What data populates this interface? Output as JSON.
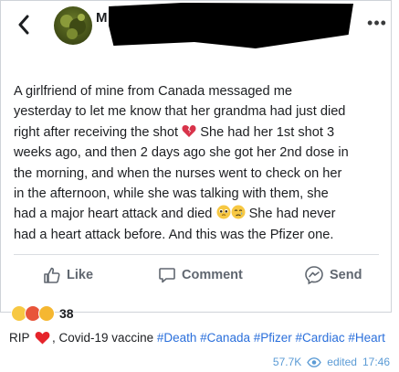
{
  "header": {
    "author_name": "M",
    "back_icon": "chevron-left-icon",
    "more_icon": "more-dots-icon",
    "more_glyph": "•••"
  },
  "post": {
    "lines": [
      "A girlfriend of mine from Canada messaged me",
      "yesterday to let me know that her grandma had just died",
      "right after receiving the shot",
      "She had her 1st shot 3",
      "weeks ago, and then 2 days ago she got her 2nd dose in",
      "the morning, and when the nurses went to check on her",
      "in the afternoon, while she was talking with them, she",
      "had a major heart attack and died",
      "She had never",
      "had a heart attack before. And this was the Pfizer one."
    ]
  },
  "actions": {
    "like": "Like",
    "comment": "Comment",
    "send": "Send"
  },
  "reactions": {
    "count": "38",
    "colors": [
      "#f7c843",
      "#e8553a",
      "#f5b731"
    ]
  },
  "caption": {
    "prefix": "RIP",
    "middle": ", Covid-19 vaccine",
    "tags": [
      "#Death",
      "#Canada",
      "#Pfizer",
      "#Cardiac",
      "#Heart"
    ]
  },
  "footer": {
    "views": "57.7K",
    "edited": "edited",
    "time": "17:46"
  },
  "colors": {
    "link": "#2a6fdb",
    "meta": "#5b9bd5",
    "action": "#606770"
  }
}
